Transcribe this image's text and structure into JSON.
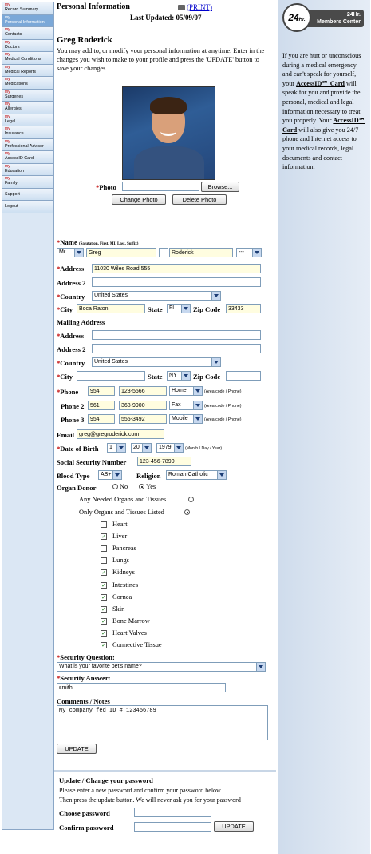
{
  "sidebar": {
    "items": [
      {
        "prefix": "my",
        "label": "Record Summary"
      },
      {
        "prefix": "my",
        "label": "Personal Information",
        "active": true
      },
      {
        "prefix": "my",
        "label": "Contacts"
      },
      {
        "prefix": "my",
        "label": "Doctors"
      },
      {
        "prefix": "my",
        "label": "Medical Conditions"
      },
      {
        "prefix": "my",
        "label": "Medical Reports"
      },
      {
        "prefix": "my",
        "label": "Medications"
      },
      {
        "prefix": "my",
        "label": "Surgeries"
      },
      {
        "prefix": "my",
        "label": "Allergies"
      },
      {
        "prefix": "my",
        "label": "Legal"
      },
      {
        "prefix": "my",
        "label": "Insurance"
      },
      {
        "prefix": "my",
        "label": "Professional Advisor"
      },
      {
        "prefix": "my",
        "label": "AccessID Card"
      },
      {
        "prefix": "my",
        "label": "Education"
      },
      {
        "prefix": "my",
        "label": "Family"
      },
      {
        "prefix": "",
        "label": "Support"
      },
      {
        "prefix": "",
        "label": "Logout"
      }
    ]
  },
  "header": {
    "title": "Personal Information",
    "print_label": "(PRINT)",
    "last_updated": "Last Updated: 05/09/07"
  },
  "profile": {
    "name": "Greg Roderick",
    "intro": "You may add to, or modify your personal information at anytime. Enter in the changes you wish to make to your profile and press the 'UPDATE' button to save your changes."
  },
  "photo": {
    "label": "Photo",
    "browse_label": "Browse...",
    "change_label": "Change Photo",
    "delete_label": "Delete Photo"
  },
  "name_fields": {
    "label": "Name",
    "hint": "(Salutation, First, MI, Last, Suffix)",
    "salutation": "Mr.",
    "first": "Greg",
    "mi": "",
    "last": "Roderick",
    "suffix": "---"
  },
  "address": {
    "address_label": "Address",
    "address": "11030 Wiles Road 555",
    "address2_label": "Address 2",
    "address2": "",
    "country_label": "Country",
    "country": "United States",
    "city_label": "City",
    "city": "Boca Raton",
    "state_label": "State",
    "state": "FL",
    "zip_label": "Zip Code",
    "zip": "33433"
  },
  "mailing": {
    "heading": "Mailing Address",
    "address_label": "Address",
    "address": "",
    "address2_label": "Address 2",
    "address2": "",
    "country_label": "Country",
    "country": "United States",
    "city_label": "City",
    "city": "",
    "state_label": "State",
    "state": "NY",
    "zip_label": "Zip Code",
    "zip": ""
  },
  "phones": [
    {
      "label": "Phone",
      "required": true,
      "area": "954",
      "number": "123-5566",
      "type": "Home",
      "hint": "(Area code / Phone)"
    },
    {
      "label": "Phone 2",
      "required": false,
      "area": "561",
      "number": "368-9900",
      "type": "Fax",
      "hint": "(Area code / Phone)"
    },
    {
      "label": "Phone 3",
      "required": false,
      "area": "954",
      "number": "555-3492",
      "type": "Mobile",
      "hint": "(Area code / Phone)"
    }
  ],
  "email": {
    "label": "Email",
    "value": "greg@gregroderick.com"
  },
  "dob": {
    "label": "Date of Birth",
    "month": "1",
    "day": "20",
    "year": "1979",
    "hint": "(Month / Day / Year)"
  },
  "ssn": {
    "label": "Social Security Number",
    "value": "123-456-7890"
  },
  "blood": {
    "label": "Blood Type",
    "value": "AB+"
  },
  "religion": {
    "label": "Religion",
    "value": "Roman Catholic"
  },
  "organ_donor": {
    "label": "Organ Donor",
    "no_label": "No",
    "yes_label": "Yes",
    "selected": "Yes",
    "any_label": "Any Needed Organs and Tissues",
    "listed_label": "Only Organs and Tissues Listed",
    "choice": "listed",
    "organs": [
      {
        "name": "Heart",
        "checked": false
      },
      {
        "name": "Liver",
        "checked": true
      },
      {
        "name": "Pancreas",
        "checked": false
      },
      {
        "name": "Lungs",
        "checked": false
      },
      {
        "name": "Kidneys",
        "checked": true
      },
      {
        "name": "Intestines",
        "checked": true
      },
      {
        "name": "Cornea",
        "checked": true
      },
      {
        "name": "Skin",
        "checked": true
      },
      {
        "name": "Bone Marrow",
        "checked": true
      },
      {
        "name": "Heart Valves",
        "checked": true
      },
      {
        "name": "Connective Tissue",
        "checked": true
      }
    ]
  },
  "security": {
    "question_label": "Security Question:",
    "question": "What is your favorite pet's name?",
    "answer_label": "Security Answer:",
    "answer": "smith"
  },
  "comments": {
    "label": "Comments / Notes",
    "value": "My company fed ID # 123456789"
  },
  "update_label": "UPDATE",
  "password": {
    "heading": "Update / Change your password",
    "line1": "Please enter a new password and confirm your password below.",
    "line2": "Then press the update button. We will never ask you for your password",
    "choose_label": "Choose password",
    "confirm_label": "Confirm password",
    "update_label": "UPDATE"
  },
  "right": {
    "logo_text": "24",
    "logo_suffix": "Hr.",
    "logo_tag1": "24Hr.",
    "logo_tag2": "Members Center",
    "blurb_1": "If you are hurt or unconscious during a medical emergency and can't speak for yourself, your ",
    "brand_1": "AccessID℠ Card",
    "blurb_2": " will speak for you and provide the personal, medical and legal information necessary to treat you properly. Your ",
    "brand_2": "AccessID℠ Card",
    "blurb_3": " will also give you 24/7 phone and Internet access to your medical records, legal documents and contact information."
  },
  "colors": {
    "accent": "#c00000",
    "sidebar": "#cfe0f2",
    "active_nav": "#7ba8d8",
    "input_fill": "#fffde0"
  }
}
